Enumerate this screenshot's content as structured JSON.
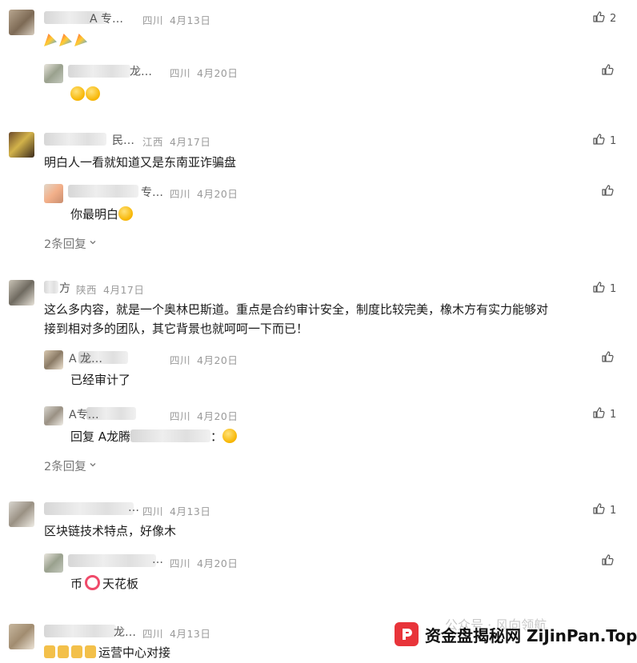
{
  "comments": [
    {
      "name": "A 专…",
      "region": "四川",
      "date": "4月13日",
      "likes": "2",
      "text": "",
      "replies": [
        {
          "name": "龙…",
          "region": "四川",
          "date": "4月20日",
          "likes": "",
          "text": ""
        }
      ]
    },
    {
      "name": "民…",
      "region": "江西",
      "date": "4月17日",
      "likes": "1",
      "text": "明白人一看就知道又是东南亚诈骗盘",
      "replies": [
        {
          "name": "专…",
          "region": "四川",
          "date": "4月20日",
          "likes": "",
          "text": "你最明白"
        }
      ],
      "more": "2条回复"
    },
    {
      "name": "方",
      "region": "陕西",
      "date": "4月17日",
      "likes": "1",
      "text_line1": "这么多内容，就是一个奥林巴斯道。重点是合约审计安全，制度比较完美，橡木方有实力能够对",
      "text_line2": "接到相对多的团队，其它背景也就呵呵一下而已！",
      "replies": [
        {
          "name": "A 龙…",
          "region": "四川",
          "date": "4月20日",
          "likes": "",
          "text": "已经审计了"
        },
        {
          "name": "A专…",
          "region": "四川",
          "date": "4月20日",
          "likes": "1",
          "text": "回复 A龙腾",
          "text_suffix": "："
        }
      ],
      "more": "2条回复"
    },
    {
      "name": "…",
      "region": "四川",
      "date": "4月13日",
      "likes": "1",
      "text": "区块链技术特点，好像木",
      "replies": [
        {
          "name": "…",
          "region": "四川",
          "date": "4月20日",
          "likes": "",
          "text_a": "币",
          "text_b": "天花板"
        }
      ]
    },
    {
      "name": "龙…",
      "region": "四川",
      "date": "4月13日",
      "likes": "",
      "text": "运营中心对接"
    }
  ],
  "watermark": {
    "brand": "资金盘揭秘网 ZiJinPan.Top",
    "faint": "公众号 · 风向领航"
  },
  "icons": {
    "like": "thumbs-up-icon",
    "chevron": "chevron-down-icon"
  }
}
